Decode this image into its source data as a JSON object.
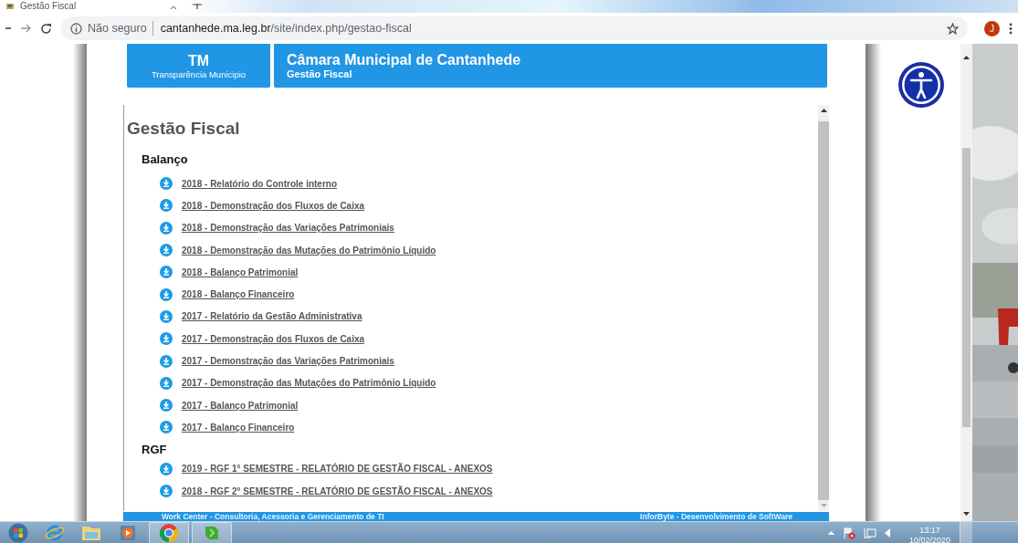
{
  "browser": {
    "tab_title": "Gestão Fiscal",
    "security": "Não seguro",
    "url_domain": "cantanhede.ma.leg.br",
    "url_path": "/site/index.php/gestao-fiscal",
    "profile_initial": "J"
  },
  "header": {
    "logo_title": "TM",
    "logo_subtitle": "Transparência Municipio",
    "title": "Câmara Municipal de Cantanhede",
    "subtitle": "Gestão Fiscal"
  },
  "page_title": "Gestão Fiscal",
  "sections": [
    {
      "heading": "Balanço",
      "documents": [
        "2018 - Relatório do Controle interno",
        "2018 - Demonstração dos Fluxos de Caixa",
        "2018 - Demonstração das Variações Patrimoniais",
        "2018 - Demonstração das Mutações do Patrimônio Líquido",
        "2018 - Balanço Patrimonial",
        "2018 - Balanço Financeiro",
        "2017 - Relatório da Gestão Administrativa",
        "2017 - Demonstração dos Fluxos de Caixa",
        "2017 - Demonstração das Variações Patrimoniais",
        "2017 - Demonstração das Mutações do Patrimônio Líquido",
        "2017 - Balanço Patrimonial",
        "2017 - Balanço Financeiro"
      ]
    },
    {
      "heading": "RGF",
      "documents": [
        "2019 - RGF 1° SEMESTRE - RELATÓRIO DE GESTÃO FISCAL - ANEXOS",
        "2018 - RGF 2° SEMESTRE - RELATÓRIO DE GESTÃO FISCAL - ANEXOS"
      ]
    }
  ],
  "footer": {
    "left": "Work Center - Consultoria, Acessoria e Gerenciamento de TI",
    "right": "InforByte - Desenvolvimento de SoftWare"
  },
  "taskbar": {
    "time": "13:17",
    "date": "10/02/2020"
  }
}
